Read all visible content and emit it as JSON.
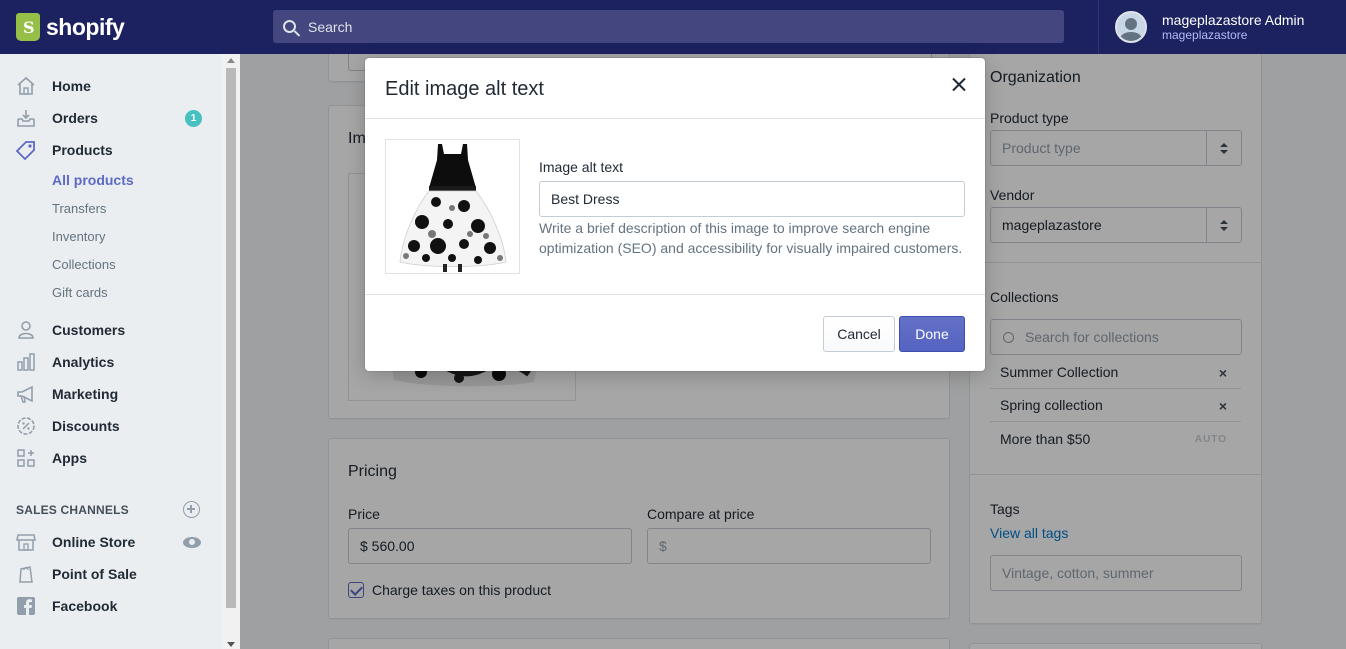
{
  "brand": {
    "name": "shopify"
  },
  "search": {
    "placeholder": "Search"
  },
  "account": {
    "name": "mageplazastore Admin",
    "store": "mageplazastore"
  },
  "sidebar": {
    "items": [
      {
        "label": "Home",
        "icon": "home-icon"
      },
      {
        "label": "Orders",
        "icon": "orders-icon",
        "badge": "1"
      },
      {
        "label": "Products",
        "icon": "tag-icon"
      },
      {
        "label": "Customers",
        "icon": "person-icon"
      },
      {
        "label": "Analytics",
        "icon": "bar-chart-icon"
      },
      {
        "label": "Marketing",
        "icon": "megaphone-icon"
      },
      {
        "label": "Discounts",
        "icon": "discount-icon"
      },
      {
        "label": "Apps",
        "icon": "apps-icon"
      }
    ],
    "products_sub": [
      "All products",
      "Transfers",
      "Inventory",
      "Collections",
      "Gift cards"
    ],
    "sales_channels_title": "SALES CHANNELS",
    "channels": [
      {
        "label": "Online Store",
        "icon": "store-icon"
      },
      {
        "label": "Point of Sale",
        "icon": "pos-icon"
      },
      {
        "label": "Facebook",
        "icon": "facebook-icon"
      }
    ]
  },
  "images_card": {
    "title_fragment": "Im"
  },
  "pricing": {
    "title": "Pricing",
    "price_label": "Price",
    "price_value": "$ 560.00",
    "compare_label": "Compare at price",
    "compare_placeholder": "$",
    "charge_taxes_label": "Charge taxes on this product",
    "charge_taxes_checked": true
  },
  "organization": {
    "title": "Organization",
    "product_type_label": "Product type",
    "product_type_placeholder": "Product type",
    "vendor_label": "Vendor",
    "vendor_value": "mageplazastore",
    "collections_label": "Collections",
    "collections_search_placeholder": "Search for collections",
    "collections": [
      {
        "name": "Summer Collection",
        "action": "×"
      },
      {
        "name": "Spring collection",
        "action": "×"
      },
      {
        "name": "More than $50",
        "action": "AUTO"
      }
    ],
    "tags_label": "Tags",
    "view_all_tags": "View all tags",
    "tags_placeholder": "Vintage, cotton, summer"
  },
  "modal": {
    "title": "Edit image alt text",
    "alt_label": "Image alt text",
    "alt_value": "Best Dress",
    "help_text": "Write a brief description of this image to improve search engine optimization (SEO) and accessibility for visually impaired customers.",
    "cancel_label": "Cancel",
    "done_label": "Done"
  },
  "colors": {
    "topbar": "#1c2260",
    "accent": "#5c6ac4",
    "badge": "#47c1bf"
  }
}
